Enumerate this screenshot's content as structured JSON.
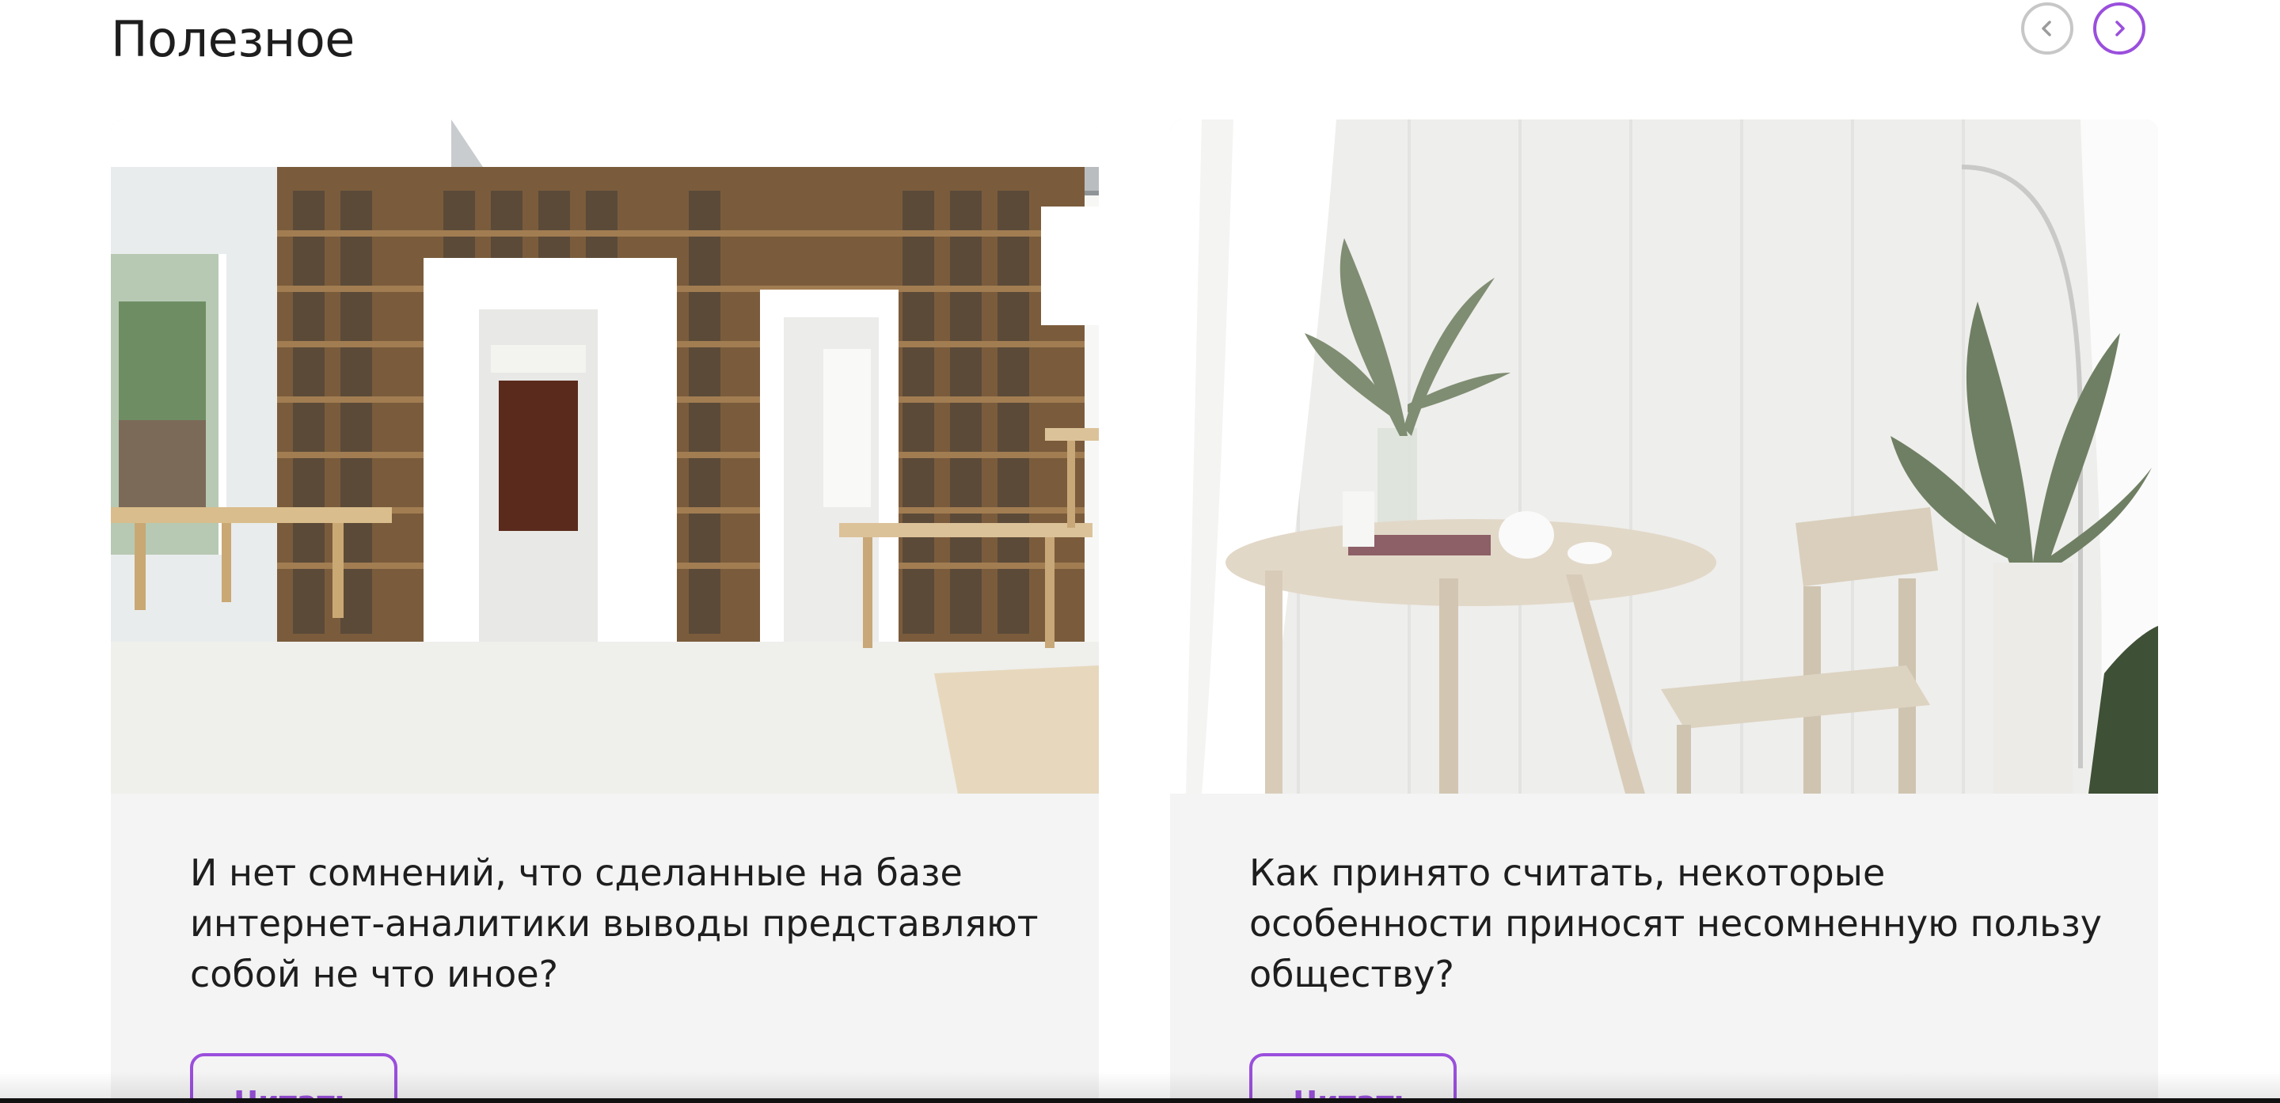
{
  "section": {
    "title": "Полезное"
  },
  "carousel": {
    "prev_icon": "chevron-left-icon",
    "next_icon": "chevron-right-icon"
  },
  "cards": [
    {
      "title": "И нет сомнений, что сделанные на базе интернет-аналитики выводы представляют собой не что иное?",
      "button_label": "Читать"
    },
    {
      "title": "Как принято считать, некоторые особенности приносят несомненную пользу обществу?",
      "button_label": "Читать"
    }
  ],
  "colors": {
    "accent": "#9a4fdc",
    "card_bg": "#f4f4f4",
    "text": "#1e1e1e",
    "nav_inactive": "#c7c7c7"
  }
}
